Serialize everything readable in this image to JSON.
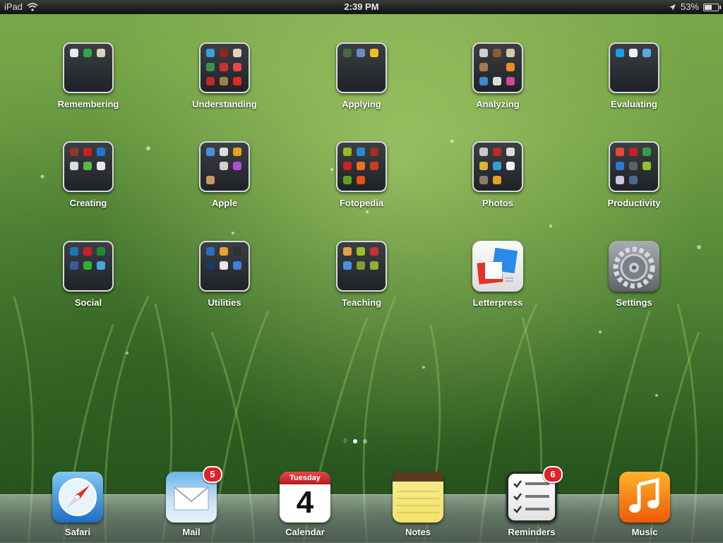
{
  "status_bar": {
    "device": "iPad",
    "time": "2:39 PM",
    "battery_percent": "53%",
    "battery_level": 0.53
  },
  "home": {
    "rows": [
      [
        "Remembering",
        "Understanding",
        "Applying",
        "Analyzing",
        "Evaluating"
      ],
      [
        "Creating",
        "Apple",
        "Fotopedia",
        "Photos",
        "Productivity"
      ],
      [
        "Social",
        "Utilities",
        "Teaching",
        "Letterpress",
        "Settings"
      ]
    ],
    "page_count": 2,
    "current_page": 1
  },
  "dock": {
    "safari": "Safari",
    "mail": "Mail",
    "mail_badge": "5",
    "calendar": "Calendar",
    "calendar_weekday": "Tuesday",
    "calendar_day": "4",
    "notes": "Notes",
    "reminders": "Reminders",
    "reminders_badge": "6",
    "music": "Music"
  },
  "colors": {
    "badge": "#e0212a",
    "wallpaper_green": "#5a8c3a"
  }
}
